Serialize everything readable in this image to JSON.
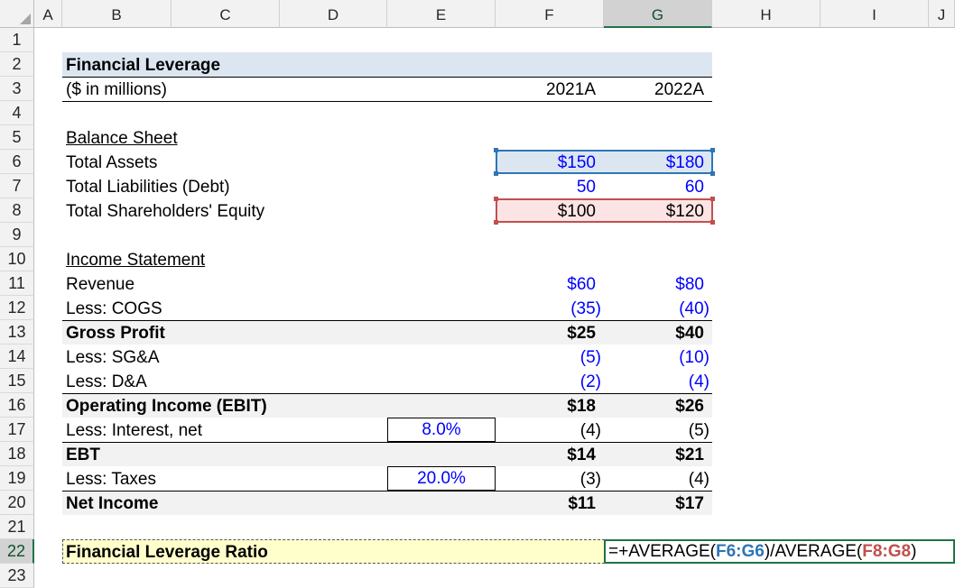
{
  "columns": [
    "A",
    "B",
    "C",
    "D",
    "E",
    "F",
    "G",
    "H",
    "I",
    "J"
  ],
  "rows": [
    "1",
    "2",
    "3",
    "4",
    "5",
    "6",
    "7",
    "8",
    "9",
    "10",
    "11",
    "12",
    "13",
    "14",
    "15",
    "16",
    "17",
    "18",
    "19",
    "20",
    "21",
    "22",
    "23"
  ],
  "header": {
    "title": "Financial Leverage",
    "units": "($ in millions)",
    "year1": "2021A",
    "year2": "2022A"
  },
  "balance_sheet": {
    "heading": "Balance Sheet",
    "rows": [
      {
        "label": "Total Assets",
        "v1": "$150",
        "v2": "$180"
      },
      {
        "label": "Total Liabilities (Debt)",
        "v1": "50",
        "v2": "60"
      },
      {
        "label": "Total Shareholders' Equity",
        "v1": "$100",
        "v2": "$120"
      }
    ]
  },
  "income_statement": {
    "heading": "Income Statement",
    "rows": [
      {
        "label": "Revenue",
        "v1": "$60",
        "v2": "$80"
      },
      {
        "label": "Less: COGS",
        "v1": "(35)",
        "v2": "(40)"
      },
      {
        "label": "Gross Profit",
        "v1": "$25",
        "v2": "$40"
      },
      {
        "label": "Less: SG&A",
        "v1": "(5)",
        "v2": "(10)"
      },
      {
        "label": "Less: D&A",
        "v1": "(2)",
        "v2": "(4)"
      },
      {
        "label": "Operating Income (EBIT)",
        "v1": "$18",
        "v2": "$26"
      },
      {
        "label": "Less: Interest, net",
        "v1": "(4)",
        "v2": "(5)",
        "input": "8.0%"
      },
      {
        "label": "EBT",
        "v1": "$14",
        "v2": "$21"
      },
      {
        "label": "Less: Taxes",
        "v1": "(3)",
        "v2": "(4)",
        "input": "20.0%"
      },
      {
        "label": "Net Income",
        "v1": "$11",
        "v2": "$17"
      }
    ]
  },
  "ratio": {
    "label": "Financial Leverage Ratio",
    "formula_prefix": "=+AVERAGE(",
    "ref1": "F6:G6",
    "formula_mid": ")/AVERAGE(",
    "ref2": "F8:G8",
    "formula_suffix": ")"
  },
  "colors": {
    "header_band": "#dce6f1",
    "shaded_band": "#f2f2f2",
    "ratio_band": "#ffffcc",
    "input_blue": "#0000ff",
    "ref1_color": "#2e75b6",
    "ref2_color": "#c0504d",
    "selection_green": "#217346"
  }
}
